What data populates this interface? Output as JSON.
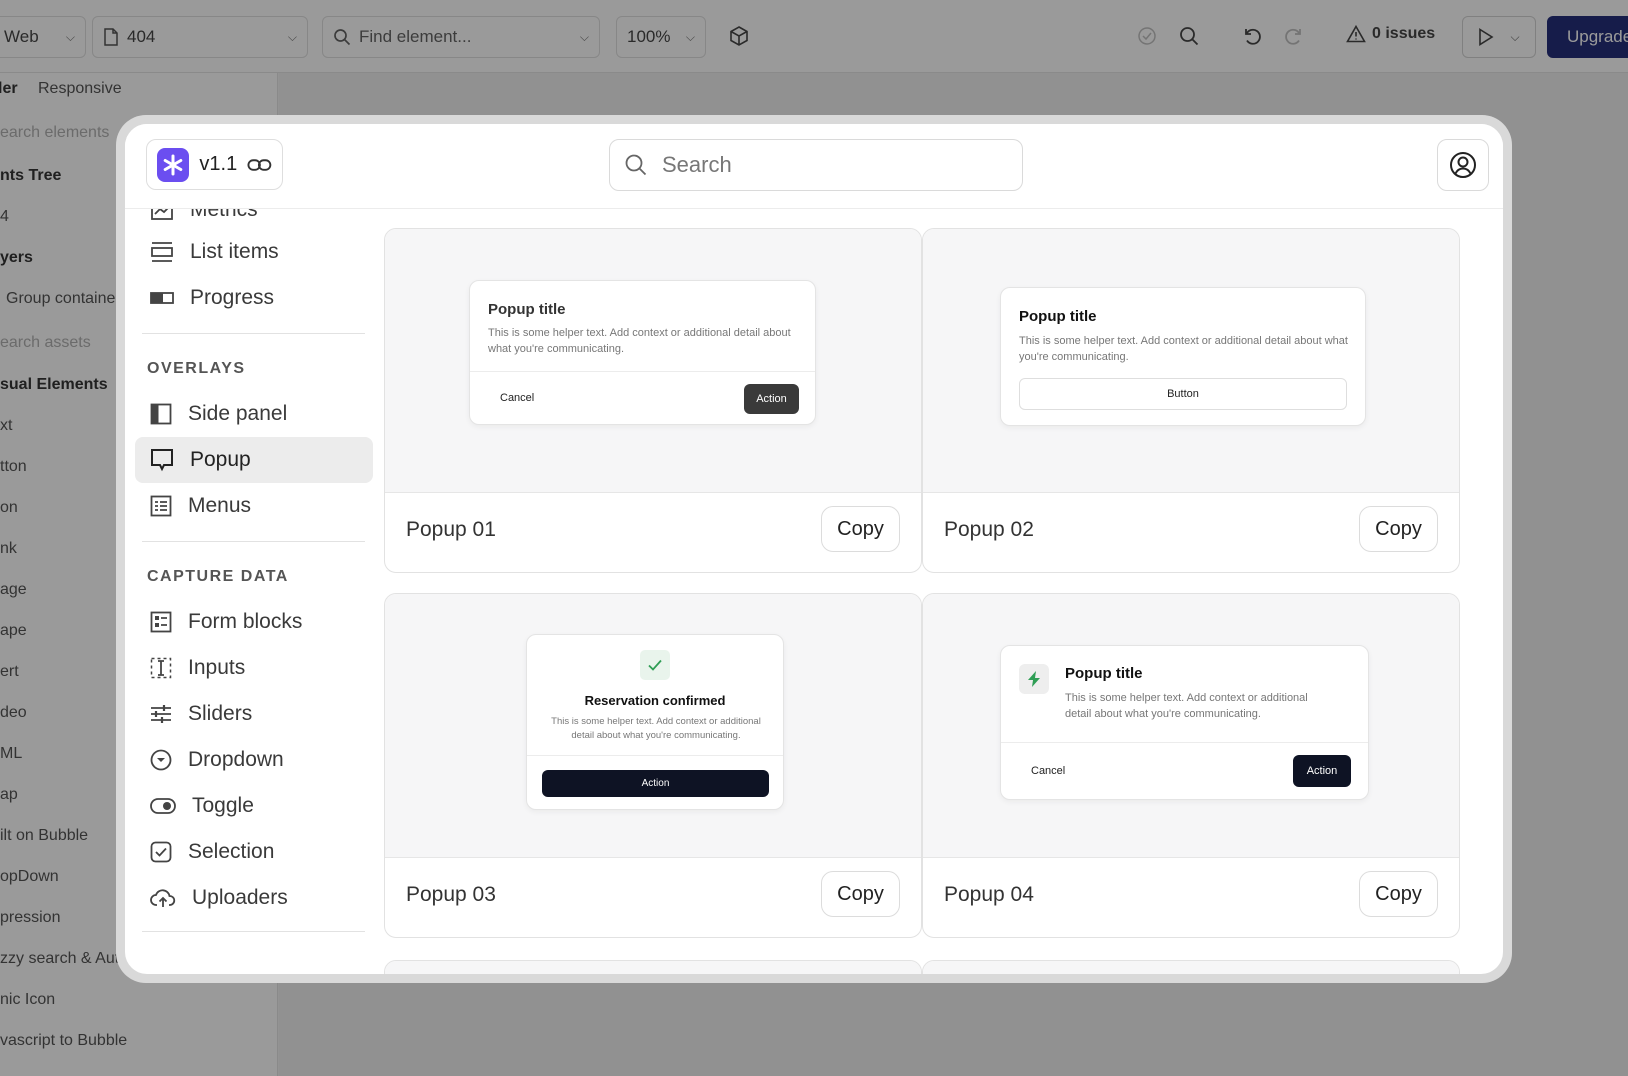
{
  "editor": {
    "topbar": {
      "platform": "Web",
      "page": "404",
      "find_placeholder": "Find element...",
      "zoom": "100%",
      "issues": "0 issues",
      "upgrade": "Upgrade"
    },
    "sidebar": {
      "tabs": [
        "ler",
        "Responsive"
      ],
      "search_elements": "earch elements",
      "elements_tree": "nts Tree",
      "page_item": "4",
      "layers": "yers",
      "group_container": "Group container",
      "search_assets": "earch assets",
      "visual_elements": "sual Elements",
      "items": [
        "xt",
        "tton",
        "on",
        "nk",
        "age",
        "ape",
        "ert",
        "deo",
        "ML",
        "ap",
        "ilt on Bubble",
        "opDown",
        "pression",
        "zzy search & Auto",
        "nic Icon",
        "vascript to Bubble"
      ]
    }
  },
  "modal": {
    "version": "v1.1",
    "search_placeholder": "Search",
    "nav": {
      "partial_item": "Metrics",
      "top_items": [
        "List items",
        "Progress"
      ],
      "overlays_title": "OVERLAYS",
      "overlays": [
        "Side panel",
        "Popup",
        "Menus"
      ],
      "capture_title": "CAPTURE DATA",
      "capture": [
        "Form blocks",
        "Inputs",
        "Sliders",
        "Dropdown",
        "Toggle",
        "Selection",
        "Uploaders"
      ]
    },
    "cards": [
      {
        "name": "Popup 01",
        "copy": "Copy",
        "preview": {
          "title": "Popup title",
          "help": "This is some helper text. Add context or additional detail about what you're communicating.",
          "cancel": "Cancel",
          "action": "Action"
        }
      },
      {
        "name": "Popup 02",
        "copy": "Copy",
        "preview": {
          "title": "Popup title",
          "help": "This is some helper text. Add context or additional detail about what you're communicating.",
          "button": "Button"
        }
      },
      {
        "name": "Popup 03",
        "copy": "Copy",
        "preview": {
          "title": "Reservation confirmed",
          "help": "This is some helper text. Add context or additional detail about what you're communicating.",
          "action": "Action"
        }
      },
      {
        "name": "Popup 04",
        "copy": "Copy",
        "preview": {
          "title": "Popup title",
          "help": "This is some helper text. Add context or additional detail about what you're communicating.",
          "cancel": "Cancel",
          "action": "Action"
        }
      }
    ]
  },
  "colors": {
    "accent": "#6b4ef0",
    "upgrade": "#101a6e",
    "dark_button": "#0e1324",
    "success": "#2f9e55"
  },
  "icons": {
    "logo": "asterisk-logo-icon",
    "link": "link-icon",
    "search": "search-icon",
    "profile": "user-circle-icon"
  }
}
